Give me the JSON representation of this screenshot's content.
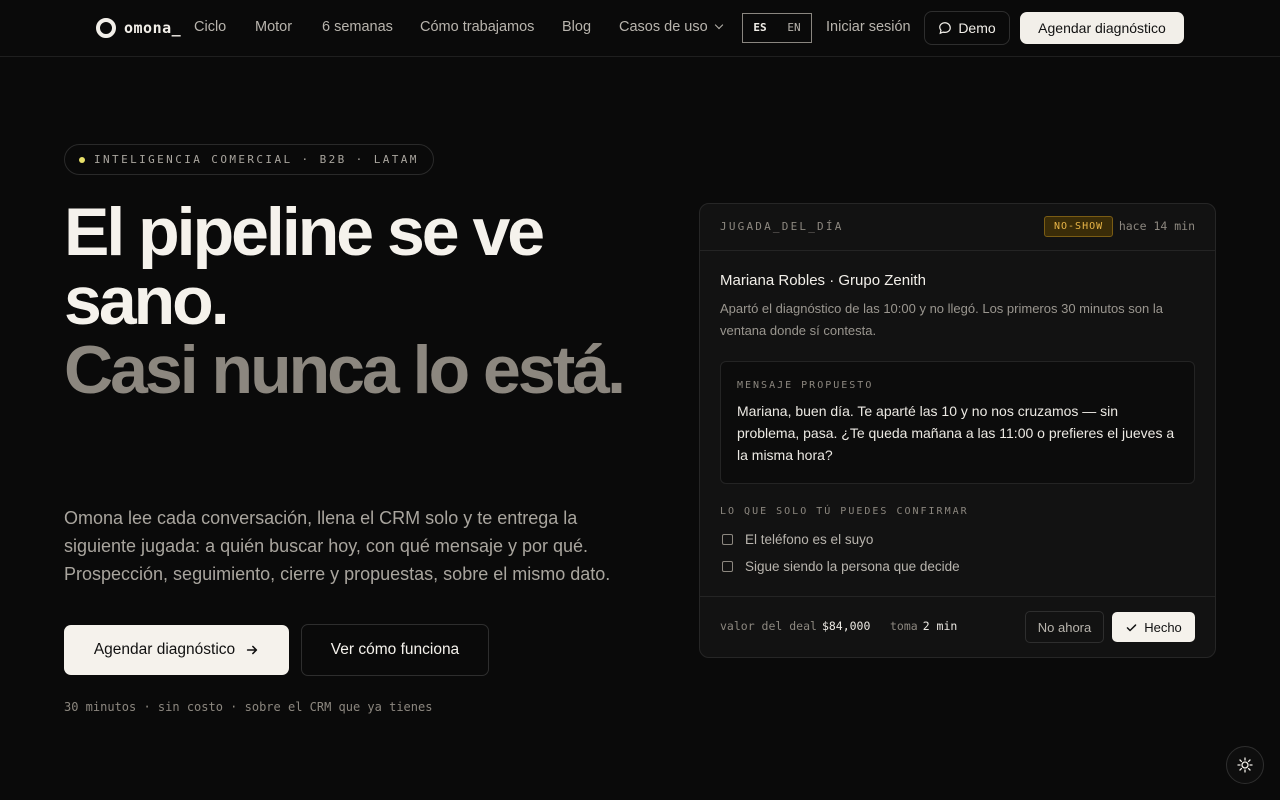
{
  "nav": {
    "logo_text": "omona_",
    "links": [
      "Ciclo",
      "Motor",
      "6 semanas",
      "Cómo trabajamos",
      "Blog"
    ],
    "dropdown_label": "Casos de uso",
    "lang_active": "ES",
    "lang_inactive": "EN",
    "login_label": "Iniciar sesión",
    "demo_label": "Demo",
    "cta_label": "Agendar diagnóstico"
  },
  "hero": {
    "pill_text": "INTELIGENCIA COMERCIAL · B2B · LATAM",
    "headline_line1": "El pipeline se ve sano.",
    "headline_line2": "Casi nunca lo está.",
    "lead": "Omona lee cada conversación, llena el CRM solo y te entrega la siguiente jugada: a quién buscar hoy, con qué mensaje y por qué. Prospección, seguimiento, cierre y propuestas, sobre el mismo dato.",
    "cta_primary": "Agendar diagnóstico",
    "cta_secondary": "Ver cómo funciona",
    "note": "30 minutos · sin costo · sobre el CRM que ya tienes"
  },
  "card": {
    "title": "JUGADA_DEL_DÍA",
    "badge": "NO-SHOW",
    "ago": "hace 14 min",
    "lead_name": "Mariana Robles · Grupo Zenith",
    "lead_desc": "Apartó el diagnóstico de las 10:00 y no llegó. Los primeros 30 minutos son la ventana donde sí contesta.",
    "message_label": "MENSAJE PROPUESTO",
    "message_text": "Mariana, buen día. Te aparté las 10 y no nos cruzamos — sin problema, pasa. ¿Te queda mañana a las 11:00 o prefieres el jueves a la misma hora?",
    "confirm_label": "LO QUE SOLO TÚ PUEDES CONFIRMAR",
    "checks": [
      "El teléfono es el suyo",
      "Sigue siendo la persona que decide"
    ],
    "deal_label": "valor del deal",
    "deal_value": "$84,000",
    "time_label": "toma",
    "time_value": "2 min",
    "btn_dismiss": "No ahora",
    "btn_done": "Hecho"
  },
  "colors": {
    "background": "#0a0a0a",
    "text": "#f2efe9",
    "muted": "#8c877f",
    "badge_amber": "#e8b547",
    "pill_dot": "#e8e06a"
  }
}
